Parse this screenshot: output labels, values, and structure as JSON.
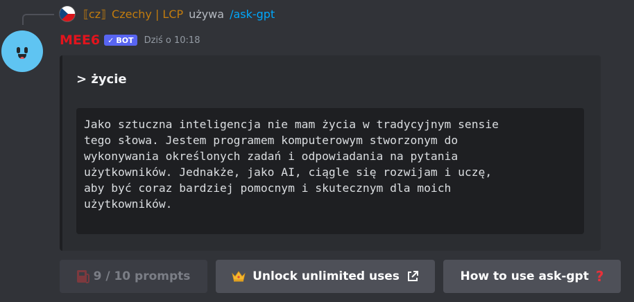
{
  "reply": {
    "server_tag": "⟦cz⟧",
    "server_name": "Czechy | LCP",
    "action": "używa",
    "command": "/ask-gpt"
  },
  "message": {
    "username": "MEE6",
    "badge": "BOT",
    "timestamp": "Dziś o 10:18"
  },
  "embed": {
    "title": "> życie",
    "body": "Jako sztuczna inteligencja nie mam życia w tradycyjnym sensie\ntego słowa. Jestem programem komputerowym stworzonym do\nwykonywania określonych zadań i odpowiadania na pytania\nużytkowników. Jednakże, jako AI, ciągle się rozwijam i uczę,\naby być coraz bardziej pomocnym i skutecznym dla moich\nużytkowników."
  },
  "buttons": [
    {
      "label": "9 / 10 prompts",
      "icon": "fuel-pump-icon",
      "disabled": true
    },
    {
      "label": "Unlock unlimited uses",
      "icon": "crown-icon",
      "trailing_icon": "external-link-icon"
    },
    {
      "label": "How to use ask-gpt",
      "trailing_icon": "question-mark-icon"
    }
  ],
  "colors": {
    "background": "#313338",
    "embed": "#2b2d31",
    "username": "#e2141d",
    "bot_badge": "#5865f2",
    "command": "#00a8fc",
    "server": "#c27c0e"
  }
}
